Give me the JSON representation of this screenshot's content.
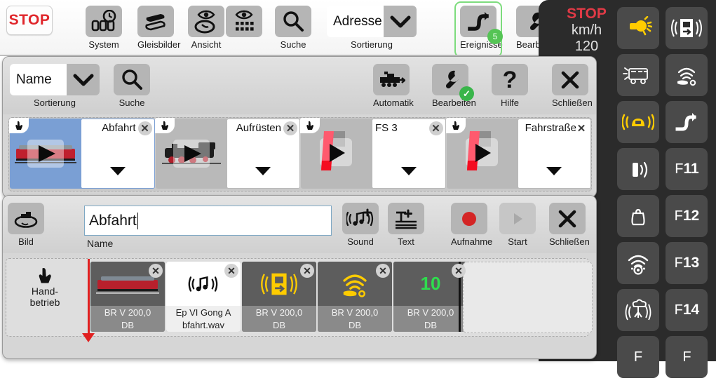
{
  "app": {
    "stop_label": "STOP"
  },
  "toolbar": {
    "items": [
      {
        "label": "System",
        "icon": "clock-counter-icon"
      },
      {
        "label": "Gleisbilder",
        "icon": "track-layers-icon"
      },
      {
        "label": "Ansicht",
        "icon": "eye-oval-icon"
      },
      {
        "label": "Suche",
        "icon": "search-icon"
      },
      {
        "label": "Sortierung",
        "icon": "chevron-down-icon",
        "value": "Adresse"
      },
      {
        "label": "Ereignisse",
        "icon": "route-step-icon",
        "badge": "5"
      },
      {
        "label": "Bearbeiten",
        "icon": "wrench-icon"
      }
    ]
  },
  "events_dialog": {
    "sort": {
      "label": "Sortierung",
      "value": "Name"
    },
    "search_label": "Suche",
    "actions": [
      {
        "label": "Automatik",
        "icon": "locomotive-icon"
      },
      {
        "label": "Bearbeiten",
        "icon": "wrench-icon",
        "badge": "check"
      },
      {
        "label": "Hilfe",
        "icon": "question-mark-icon"
      },
      {
        "label": "Schließen",
        "icon": "close-icon"
      }
    ],
    "tiles": [
      {
        "name": "Abfahrt",
        "icon": "red-loco-play-icon",
        "selected": true
      },
      {
        "name": "Aufrüsten",
        "icon": "steam-loco-play-icon",
        "selected": false
      },
      {
        "name": "FS 3",
        "icon": "route-switch-play-icon",
        "selected": false
      },
      {
        "name": "Fahrstraße",
        "icon": "route-switch-play-icon",
        "selected": false
      }
    ]
  },
  "editor_dialog": {
    "image_label": "Bild",
    "image_icon": "loco-outline-icon",
    "name_label": "Name",
    "name_value": "Abfahrt",
    "actions": [
      {
        "label": "Sound",
        "icon": "sound-plus-icon"
      },
      {
        "label": "Text",
        "icon": "text-plus-icon"
      },
      {
        "label": "Aufnahme",
        "icon": "record-dot-icon"
      },
      {
        "label": "Start",
        "icon": "play-icon",
        "disabled": true
      },
      {
        "label": "Schließen",
        "icon": "close-icon"
      }
    ],
    "hand_mode_label_1": "Hand-",
    "hand_mode_label_2": "betrieb",
    "timeline": [
      {
        "caption_1": "BR V 200,0",
        "caption_2": "DB",
        "icon": "red-loco-icon",
        "style": "dark"
      },
      {
        "caption_1": "Ep VI Gong A",
        "caption_2": "bfahrt.wav",
        "icon": "sound-icon",
        "style": "white"
      },
      {
        "caption_1": "BR V 200,0",
        "caption_2": "DB",
        "icon": "door-signal-icon",
        "style": "dark"
      },
      {
        "caption_1": "BR V 200,0",
        "caption_2": "DB",
        "icon": "horn-wifi-icon",
        "style": "dark"
      },
      {
        "caption_1": "BR V 200,0",
        "caption_2": "DB",
        "icon": "number-icon",
        "value": "10",
        "style": "dark"
      }
    ]
  },
  "right_panel": {
    "stop_label": "STOP",
    "unit_label": "km/h",
    "speed_value": "120",
    "keys": [
      {
        "icon": "light-sun-icon",
        "active": true
      },
      {
        "icon": "door-signal-icon",
        "active": false
      },
      {
        "icon": "coach-light-icon",
        "active": false
      },
      {
        "icon": "horn-wifi-icon",
        "active": false
      },
      {
        "icon": "cab-light-icon",
        "active": true
      },
      {
        "icon": "route-step-icon",
        "active": false
      },
      {
        "icon": "whistle-icon",
        "active": false
      },
      {
        "icon": "f-key-icon",
        "label": "F",
        "number": "11"
      },
      {
        "icon": "bell-weight-icon",
        "active": false
      },
      {
        "icon": "f-key-icon",
        "label": "F",
        "number": "12"
      },
      {
        "icon": "radio-wave-icon",
        "active": false
      },
      {
        "icon": "f-key-icon",
        "label": "F",
        "number": "13"
      },
      {
        "icon": "steam-puff-icon",
        "active": false
      },
      {
        "icon": "f-key-icon",
        "label": "F",
        "number": "14"
      },
      {
        "icon": "f-key-icon",
        "label": "F",
        "number": ""
      },
      {
        "icon": "f-key-icon",
        "label": "F",
        "number": ""
      }
    ]
  },
  "colors": {
    "accent_red": "#e0262b",
    "accent_yellow": "#ffcc00",
    "accent_green": "#39b54a",
    "selection_blue": "#7a9fd4",
    "panel_dark": "#2b2b2b"
  }
}
